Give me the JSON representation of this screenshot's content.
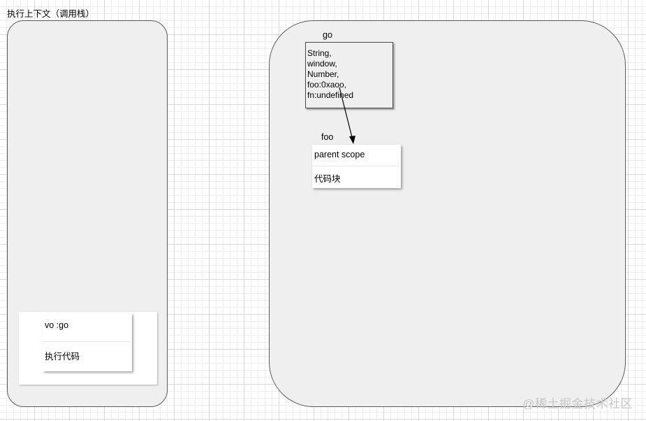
{
  "title": "执行上下文（调用栈）",
  "go": {
    "label": "go",
    "lines": [
      "String,",
      "window,",
      "Number,",
      "foo:0xaoo,",
      "fn:undefined"
    ]
  },
  "foo": {
    "label": "foo",
    "parent_scope": "parent scope",
    "code_block": "代码块"
  },
  "stack": {
    "vo": "vo :go",
    "exec": "执行代码"
  },
  "watermark": "@稀土掘金技术社区"
}
